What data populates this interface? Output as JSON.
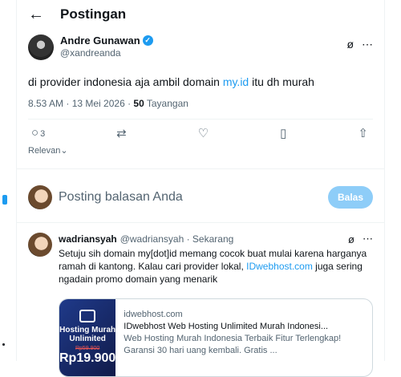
{
  "header": {
    "title": "Postingan"
  },
  "post": {
    "author": "Andre Gunawan",
    "handle": "@xandreanda",
    "text_before": "di provider indonesia aja ambil domain ",
    "link_text": "my.id",
    "text_after": " itu dh murah",
    "timestamp": "8.53 AM · 13 Mei 2026 · ",
    "views_count": "50",
    "views_label": " Tayangan",
    "reply_count": "3"
  },
  "sort_label": "Relevan",
  "reply_box": {
    "placeholder": "Posting balasan Anda",
    "button": "Balas"
  },
  "reply": {
    "name": "wadriansyah",
    "handle_time": "@wadriansyah · Sekarang",
    "text_before": "Setuju sih domain my[dot]id memang cocok buat mulai karena harganya ramah di kantong. Kalau cari provider lokal, ",
    "link_text": "IDwebhost.com",
    "text_after": " juga sering ngadain promo domain yang menarik"
  },
  "card": {
    "img_title": "Hosting Murah Unlimited",
    "old_price": "Rp59.900",
    "price": "Rp19.900",
    "domain": "idwebhost.com",
    "headline": "IDwebhost Web Hosting Unlimited Murah Indonesi...",
    "desc": "Web Hosting Murah Indonesia Terbaik Fitur Terlengkap! Garansi 30 hari uang kembali. Gratis ..."
  }
}
